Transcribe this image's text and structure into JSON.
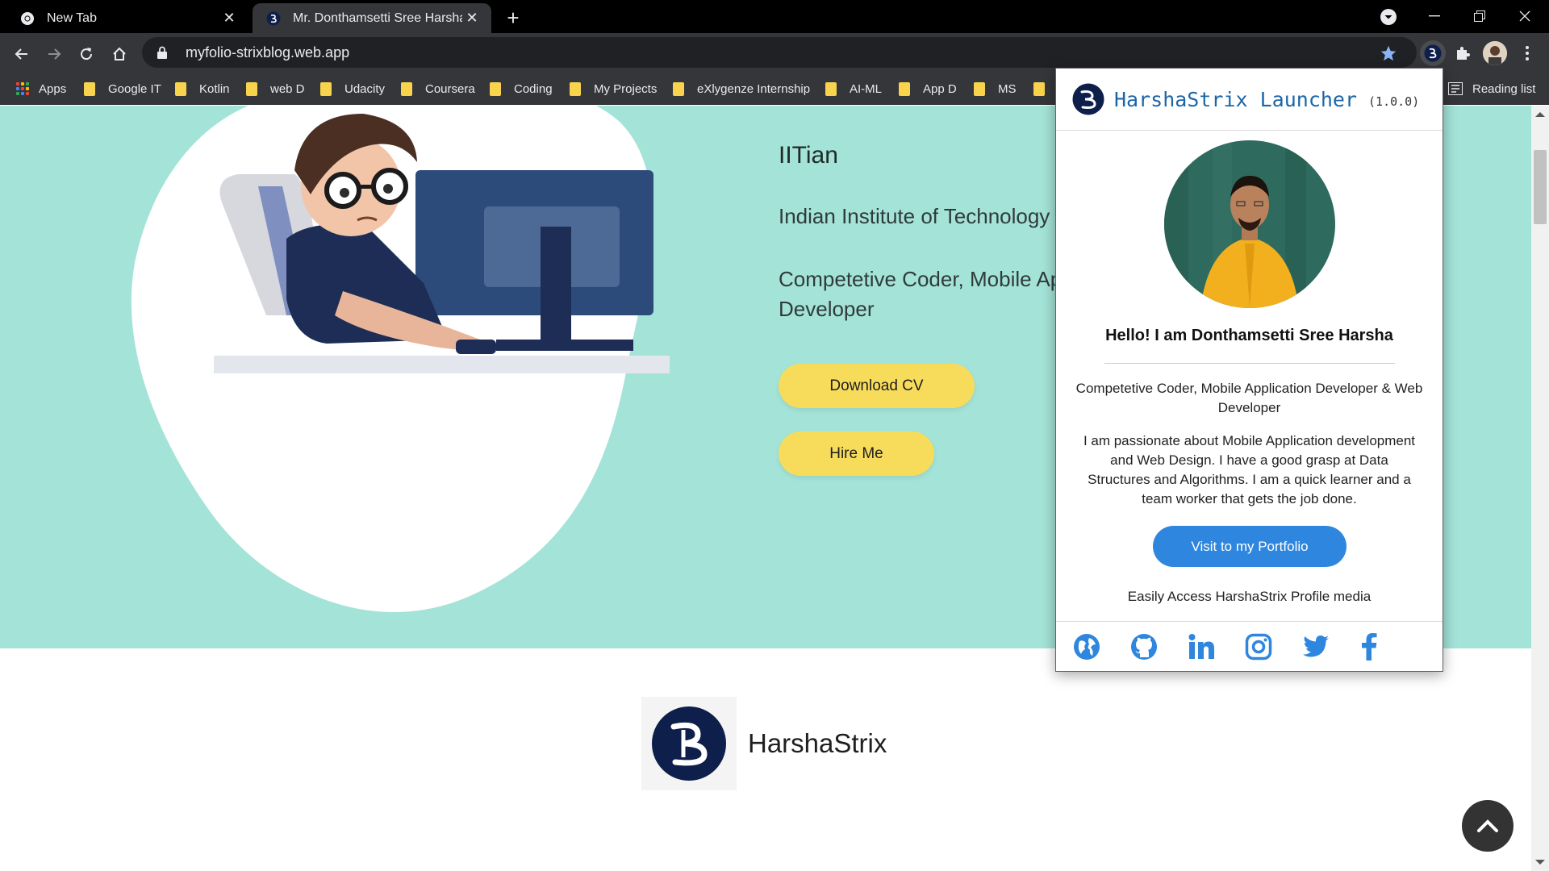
{
  "browser": {
    "tabs": [
      {
        "title": "New Tab",
        "active": false
      },
      {
        "title": "Mr. Donthamsetti Sree Harsha",
        "active": true
      }
    ],
    "url": "myfolio-strixblog.web.app",
    "bookmarks": [
      "Apps",
      "Google IT",
      "Kotlin",
      "web D",
      "Udacity",
      "Coursera",
      "Coding",
      "My Projects",
      "eXlygenze Internship",
      "AI-ML",
      "App D",
      "MS"
    ],
    "reading_list": "Reading list"
  },
  "hero": {
    "title": "IITian",
    "institute": "Indian Institute of Technology",
    "role": "Competetive Coder, Mobile Ap",
    "role_line2": "Developer",
    "download_cv": "Download CV",
    "hire_me": "Hire Me"
  },
  "brand": {
    "name": "HarshaStrix"
  },
  "popup": {
    "title": "HarshaStrix Launcher",
    "version": "(1.0.0)",
    "greeting": "Hello! I am Donthamsetti Sree Harsha",
    "roles": "Competetive Coder, Mobile Application Developer & Web Developer",
    "about": "I am passionate about Mobile Application development and Web Design. I have a good grasp at Data Structures and Algorithms. I am a quick learner and a team worker that gets the job done.",
    "portfolio_button": "Visit to my Portfolio",
    "media_text": "Easily Access HarshaStrix Profile media",
    "social_icons": [
      "globe-icon",
      "github-icon",
      "linkedin-icon",
      "instagram-icon",
      "twitter-icon",
      "facebook-icon"
    ]
  },
  "colors": {
    "hero_bg": "#a4e3d8",
    "button_yellow": "#f7dc5c",
    "popup_blue": "#2e86de",
    "navy": "#0d1f4a"
  }
}
